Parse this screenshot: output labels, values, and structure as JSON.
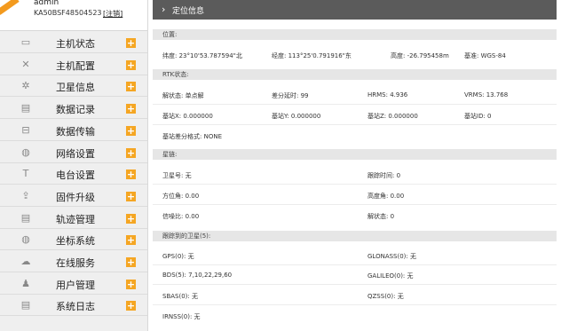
{
  "user": {
    "name": "admin",
    "serial": "KA50BSF48504523",
    "logout": "[注销]"
  },
  "nav": [
    {
      "icon": "monitor-icon",
      "glyph": "▭",
      "label": "主机状态"
    },
    {
      "icon": "tools-icon",
      "glyph": "✕",
      "label": "主机配置"
    },
    {
      "icon": "satellite-icon",
      "glyph": "✲",
      "label": "卫星信息"
    },
    {
      "icon": "calendar-icon",
      "glyph": "▤",
      "label": "数据记录"
    },
    {
      "icon": "transfer-icon",
      "glyph": "⊟",
      "label": "数据传输"
    },
    {
      "icon": "globe-icon",
      "glyph": "◍",
      "label": "网络设置"
    },
    {
      "icon": "antenna-icon",
      "glyph": "T",
      "label": "电台设置"
    },
    {
      "icon": "upload-icon",
      "glyph": "⇪",
      "label": "固件升级"
    },
    {
      "icon": "calendar-icon",
      "glyph": "▤",
      "label": "轨迹管理"
    },
    {
      "icon": "globe-icon",
      "glyph": "◍",
      "label": "坐标系统"
    },
    {
      "icon": "cloud-icon",
      "glyph": "☁",
      "label": "在线服务"
    },
    {
      "icon": "users-icon",
      "glyph": "♟",
      "label": "用户管理"
    },
    {
      "icon": "calendar-icon",
      "glyph": "▤",
      "label": "系统日志"
    }
  ],
  "plus_symbol": "+",
  "title": "定位信息",
  "position": {
    "header": "位置:",
    "lat": "纬度: 23°10'53.787594\"北",
    "lon": "经度: 113°25'0.791916\"东",
    "height": "高度: -26.795458m",
    "datum": "基准: WGS-84"
  },
  "rtk": {
    "header": "RTK状态:",
    "solution": "解状态: 单点解",
    "diff_delay": "差分延时: 99",
    "hrms": "HRMS: 4.936",
    "vrms": "VRMS: 13.768",
    "base_x": "基站X: 0.000000",
    "base_y": "基站Y: 0.000000",
    "base_z": "基站Z: 0.000000",
    "base_id": "基站ID: 0",
    "diff_format": "基站差分格式: NONE"
  },
  "stars": {
    "header": "星链:",
    "sat_no": "卫星号: 无",
    "track_time": "跟踪时间: 0",
    "azimuth": "方位角: 0.00",
    "elevation": "高度角: 0.00",
    "snr": "信噪比: 0.00",
    "state": "解状态: 0"
  },
  "tracked": {
    "header": "跟踪到的卫星(5):",
    "gps": "GPS(0): 无",
    "glonass": "GLONASS(0): 无",
    "bds": "BDS(5): 7,10,22,29,60",
    "galileo": "GALILEO(0): 无",
    "sbas": "SBAS(0): 无",
    "qzss": "QZSS(0): 无",
    "irnss": "IRNSS(0): 无"
  }
}
